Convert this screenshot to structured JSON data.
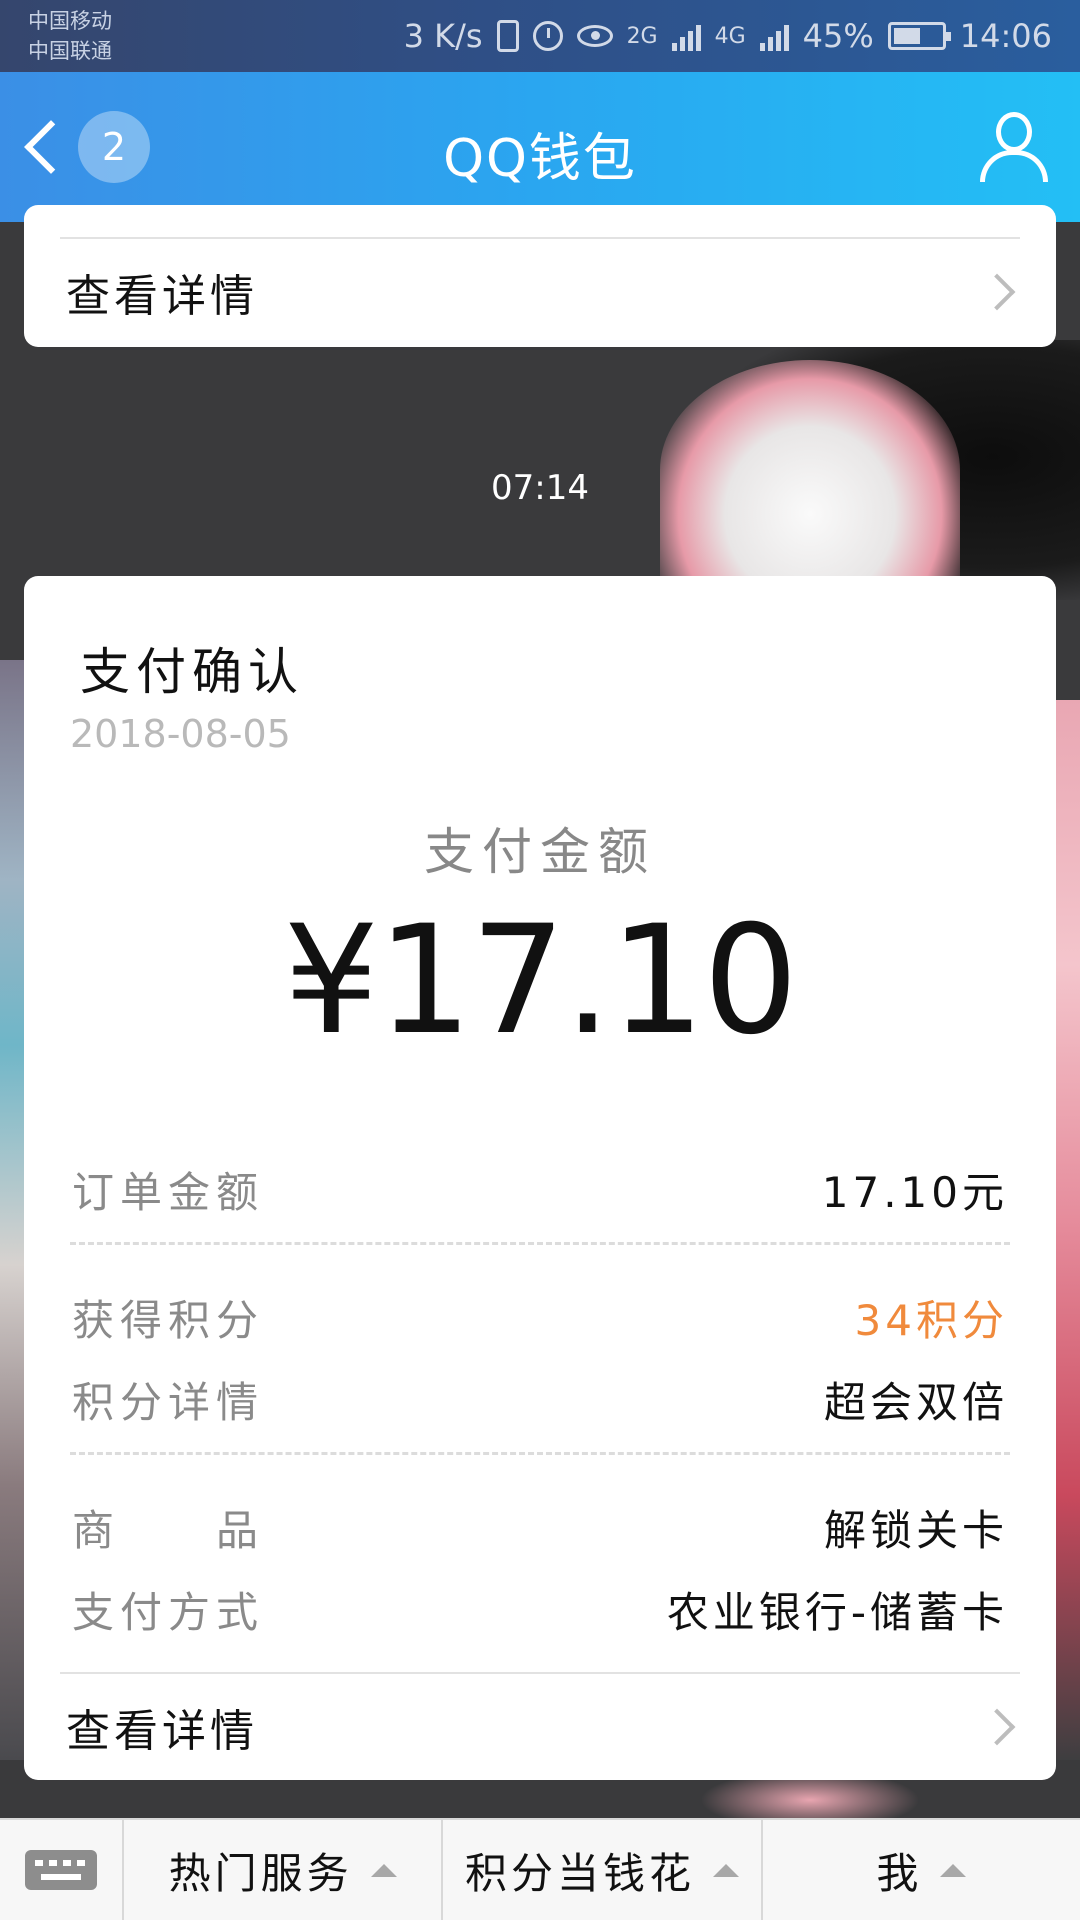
{
  "status_bar": {
    "carrier_1": "中国移动",
    "carrier_2": "中国联通",
    "net_speed": "3 K/s",
    "net_2g": "2G",
    "net_4g": "4G",
    "battery_pct": "45%",
    "time": "14:06"
  },
  "header": {
    "back_badge": "2",
    "title": "QQ钱包"
  },
  "top_card": {
    "details_label": "查看详情"
  },
  "timestamp": "07:14",
  "payment_card": {
    "title": "支付确认",
    "date": "2018-08-05",
    "amount_label": "支付金额",
    "amount": "¥17.10",
    "rows": [
      {
        "key": "订单金额",
        "value": "17.10元"
      },
      {
        "key": "获得积分",
        "value": "34积分"
      },
      {
        "key": "积分详情",
        "value": "超会双倍"
      },
      {
        "key": "商　　品",
        "value": "解锁关卡"
      },
      {
        "key": "支付方式",
        "value": "农业银行-储蓄卡"
      }
    ],
    "details_label": "查看详情"
  },
  "bottom_nav": {
    "tabs": [
      {
        "label": "热门服务"
      },
      {
        "label": "积分当钱花"
      },
      {
        "label": "我"
      }
    ]
  },
  "colors": {
    "accent_orange": "#f08a3c",
    "header_blue": "#2aa6f0"
  }
}
